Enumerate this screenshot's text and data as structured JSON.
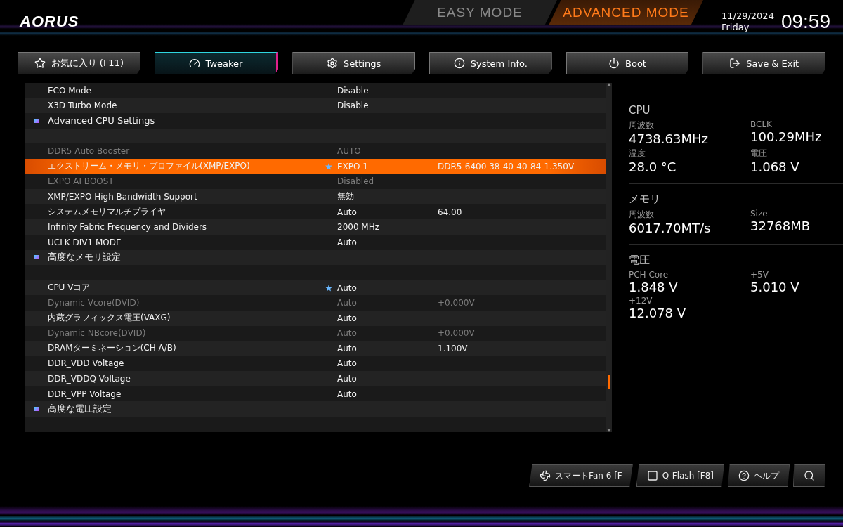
{
  "logo": "AORUS",
  "modes": [
    {
      "label": "EASY MODE",
      "selected": false
    },
    {
      "label": "ADVANCED MODE",
      "selected": true
    }
  ],
  "clock": {
    "date": "11/29/2024",
    "day": "Friday",
    "time": "09:59"
  },
  "tabs": [
    {
      "label": "お気に入り (F11)",
      "kind": "favorites",
      "selected": false
    },
    {
      "label": "Tweaker",
      "kind": "gauge",
      "selected": true
    },
    {
      "label": "Settings",
      "kind": "gear",
      "selected": false
    },
    {
      "label": "System Info.",
      "kind": "info",
      "selected": false
    },
    {
      "label": "Boot",
      "kind": "power",
      "selected": false
    },
    {
      "label": "Save & Exit",
      "kind": "exit",
      "selected": false
    }
  ],
  "settings": [
    {
      "kind": "setting",
      "name": "ECO Mode",
      "value": "Disable",
      "disabled": false,
      "selected": false,
      "starred": false
    },
    {
      "kind": "setting",
      "name": "X3D Turbo Mode",
      "value": "Disable",
      "disabled": false,
      "selected": false,
      "starred": false
    },
    {
      "kind": "section",
      "name": "Advanced CPU Settings"
    },
    {
      "kind": "blank"
    },
    {
      "kind": "setting",
      "name": "DDR5 Auto Booster",
      "value": "AUTO",
      "disabled": true,
      "selected": false,
      "starred": false
    },
    {
      "kind": "setting",
      "name": "エクストリーム・メモリ・プロファイル(XMP/EXPO)",
      "value": "EXPO 1",
      "extra": "DDR5-6400 38-40-40-84-1.350V",
      "disabled": false,
      "selected": true,
      "starred": true
    },
    {
      "kind": "setting",
      "name": "EXPO AI BOOST",
      "value": "Disabled",
      "disabled": true,
      "selected": false,
      "starred": false
    },
    {
      "kind": "setting",
      "name": "XMP/EXPO High Bandwidth Support",
      "value": "無効",
      "disabled": false,
      "selected": false,
      "starred": false
    },
    {
      "kind": "setting",
      "name": "システムメモリマルチプライヤ",
      "value": "Auto",
      "extra": "64.00",
      "disabled": false,
      "selected": false,
      "starred": false
    },
    {
      "kind": "setting",
      "name": "Infinity Fabric Frequency and Dividers",
      "value": "2000 MHz",
      "disabled": false,
      "selected": false,
      "starred": false
    },
    {
      "kind": "setting",
      "name": "UCLK DIV1 MODE",
      "value": "Auto",
      "disabled": false,
      "selected": false,
      "starred": false
    },
    {
      "kind": "section",
      "name": "高度なメモリ設定"
    },
    {
      "kind": "blank"
    },
    {
      "kind": "setting",
      "name": "CPU Vコア",
      "value": "Auto",
      "disabled": false,
      "selected": false,
      "starred": true
    },
    {
      "kind": "setting",
      "name": "Dynamic Vcore(DVID)",
      "value": "Auto",
      "extra": "+0.000V",
      "disabled": true,
      "selected": false,
      "starred": false
    },
    {
      "kind": "setting",
      "name": "内蔵グラフィックス電圧(VAXG)",
      "value": "Auto",
      "disabled": false,
      "selected": false,
      "starred": false
    },
    {
      "kind": "setting",
      "name": "Dynamic NBcore(DVID)",
      "value": "Auto",
      "extra": "+0.000V",
      "disabled": true,
      "selected": false,
      "starred": false
    },
    {
      "kind": "setting",
      "name": "DRAMターミネーション(CH A/B)",
      "value": "Auto",
      "extra": "1.100V",
      "disabled": false,
      "selected": false,
      "starred": false
    },
    {
      "kind": "setting",
      "name": "DDR_VDD Voltage",
      "value": "Auto",
      "disabled": false,
      "selected": false,
      "starred": false
    },
    {
      "kind": "setting",
      "name": "DDR_VDDQ Voltage",
      "value": "Auto",
      "disabled": false,
      "selected": false,
      "starred": false
    },
    {
      "kind": "setting",
      "name": "DDR_VPP Voltage",
      "value": "Auto",
      "disabled": false,
      "selected": false,
      "starred": false
    },
    {
      "kind": "section",
      "name": "高度な電圧設定"
    },
    {
      "kind": "blank"
    }
  ],
  "monitor": [
    {
      "title": "CPU",
      "items": [
        {
          "label": "周波数",
          "value": "4738.63MHz"
        },
        {
          "label": "BCLK",
          "value": "100.29MHz"
        },
        {
          "label": "温度",
          "value": "28.0 °C"
        },
        {
          "label": "電圧",
          "value": "1.068 V"
        }
      ]
    },
    {
      "title": "メモリ",
      "items": [
        {
          "label": "周波数",
          "value": "6017.70MT/s"
        },
        {
          "label": "Size",
          "value": "32768MB"
        }
      ]
    },
    {
      "title": "電圧",
      "items": [
        {
          "label": "PCH Core",
          "value": "1.848 V"
        },
        {
          "label": "+5V",
          "value": "5.010 V"
        },
        {
          "label": "+12V",
          "value": "12.078 V"
        }
      ]
    }
  ],
  "bottom_buttons": [
    {
      "label": "スマートFan 6 [F",
      "kind": "fan"
    },
    {
      "label": "Q-Flash [F8]",
      "kind": "chip"
    },
    {
      "label": "ヘルプ",
      "kind": "help"
    },
    {
      "kind": "search"
    }
  ]
}
